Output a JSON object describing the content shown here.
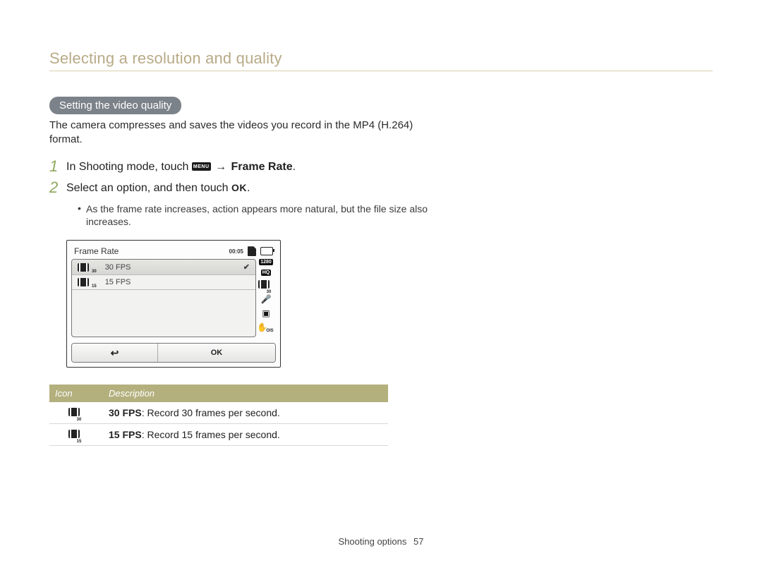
{
  "page_title": "Selecting a resolution and quality",
  "pill": "Setting the video quality",
  "intro": "The camera compresses and saves the videos you record in the MP4 (H.264) format.",
  "steps": {
    "s1_num": "1",
    "s1_a": "In Shooting mode, touch ",
    "s1_menu": "MENU",
    "s1_arrow": " → ",
    "s1_target": "Frame Rate",
    "s1_end": ".",
    "s2_num": "2",
    "s2_a": "Select an option, and then touch ",
    "s2_ok": "OK",
    "s2_end": ".",
    "bullet": "As the frame rate increases, action appears more natural, but the file size also increases."
  },
  "shot": {
    "title": "Frame Rate",
    "time": "00:05",
    "opt30": "30 FPS",
    "sub30": "30",
    "opt15": "15 FPS",
    "sub15": "15",
    "badge1": "1280",
    "badge2": "HQ",
    "sideSub": "30",
    "oisSub": "OIS",
    "back": "↩",
    "ok": "OK"
  },
  "table": {
    "h_icon": "Icon",
    "h_desc": "Description",
    "rows": [
      {
        "sub": "30",
        "b": "30 FPS",
        "txt": ": Record 30 frames per second."
      },
      {
        "sub": "15",
        "b": "15 FPS",
        "txt": ": Record 15 frames per second."
      }
    ]
  },
  "footer": {
    "section": "Shooting options",
    "page": "57"
  }
}
